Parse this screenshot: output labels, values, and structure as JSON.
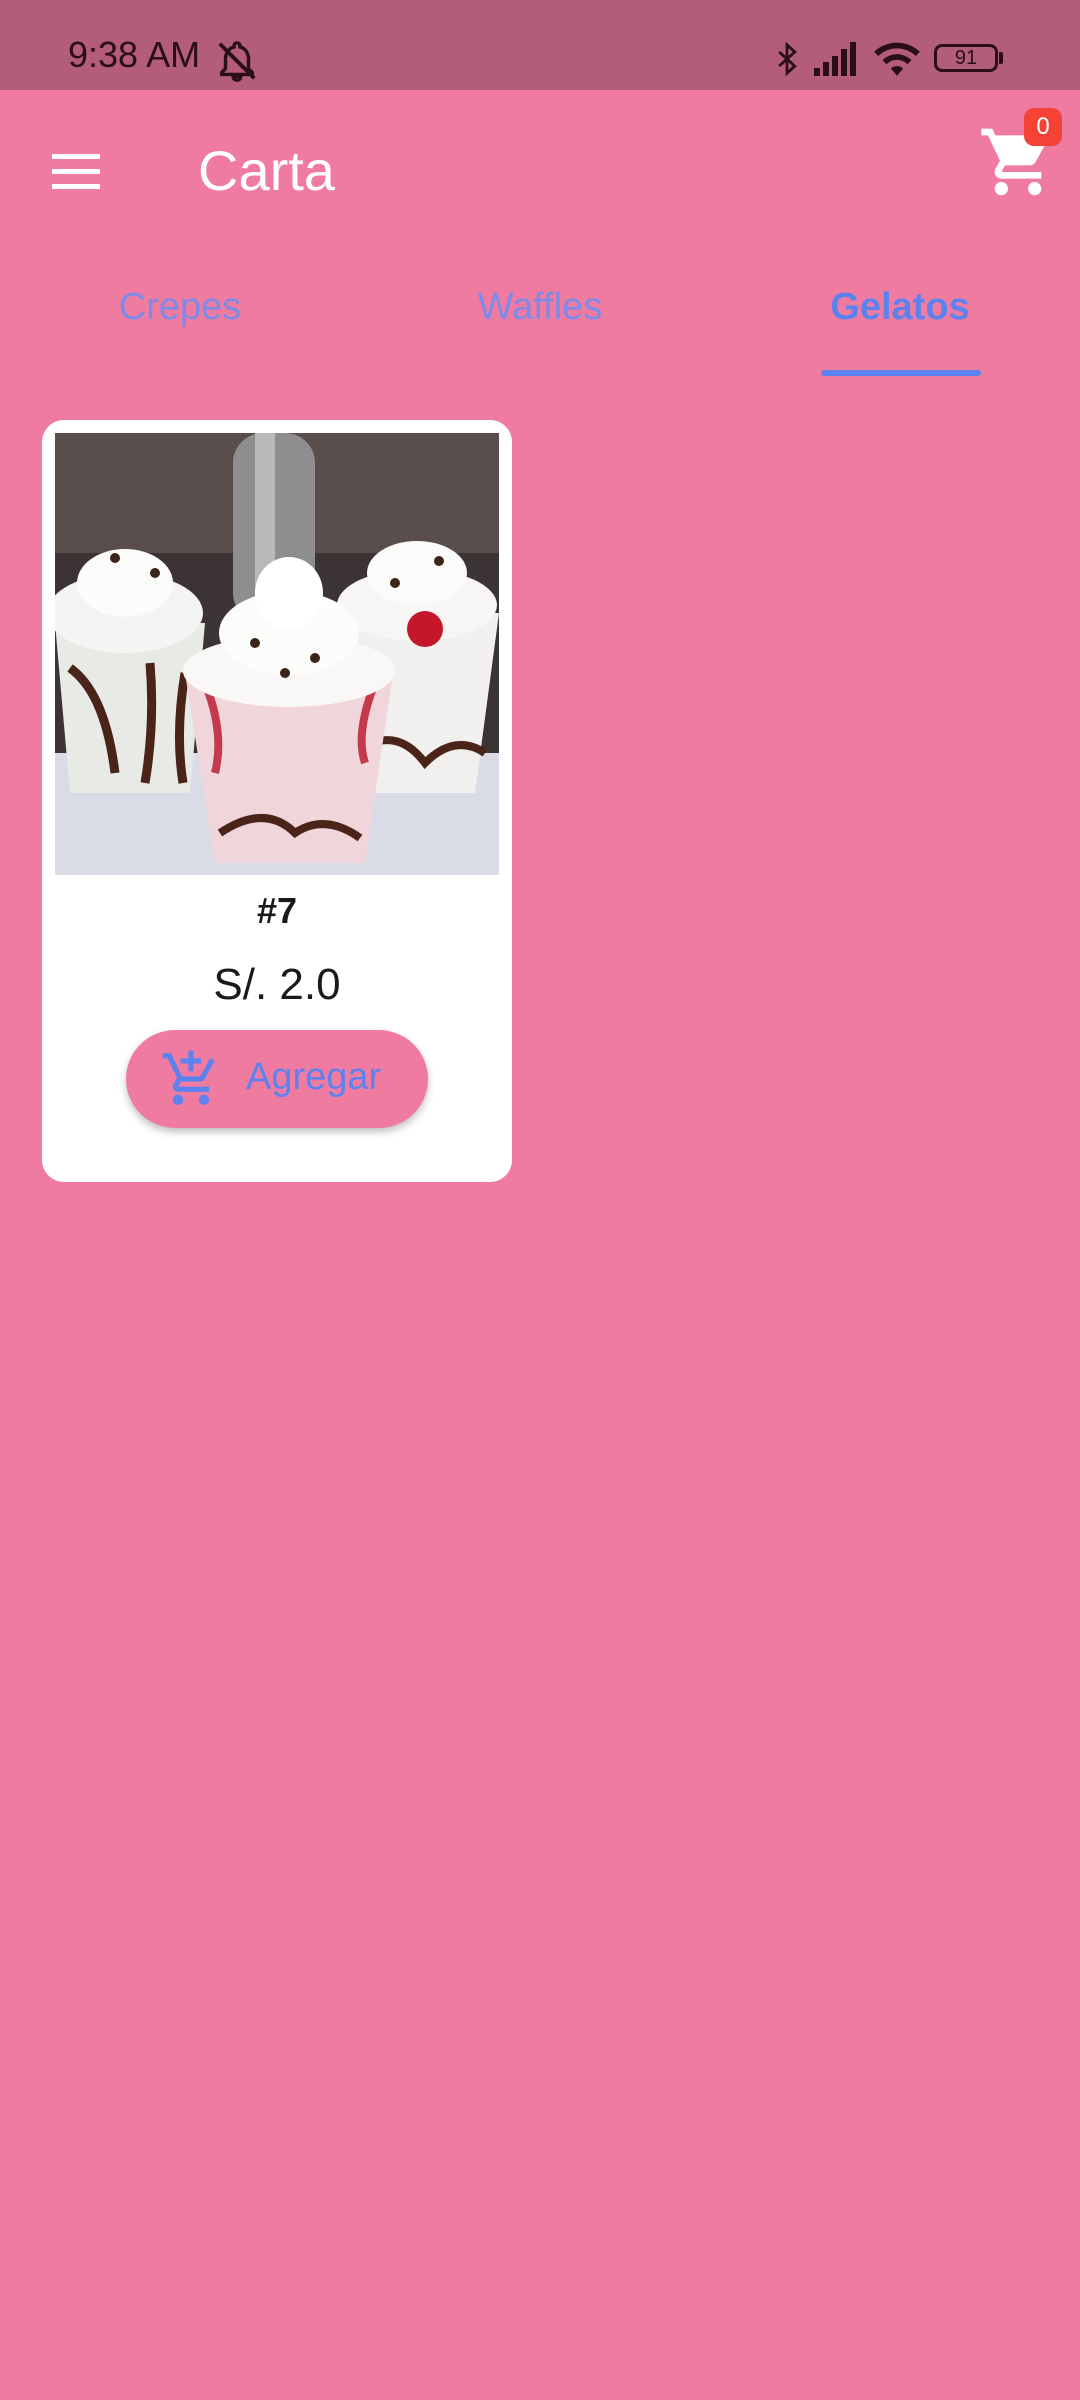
{
  "status_bar": {
    "time": "9:38 AM",
    "battery": "91",
    "icons": [
      "mute-icon",
      "bluetooth-icon",
      "signal-icon",
      "wifi-icon",
      "battery-icon"
    ]
  },
  "app_bar": {
    "title": "Carta",
    "cart_count": "0",
    "icons": [
      "menu-icon",
      "cart-icon"
    ]
  },
  "tabs": [
    {
      "label": "Crepes",
      "active": false
    },
    {
      "label": "Waffles",
      "active": false
    },
    {
      "label": "Gelatos",
      "active": true
    }
  ],
  "products": [
    {
      "name": "#7",
      "price": "S/. 2.0",
      "button_label": "Agregar",
      "button_icon": "add-to-cart-icon"
    }
  ],
  "colors": {
    "background": "#F07BA1",
    "status_bar": "#B35D7B",
    "accent": "#5C82F0",
    "badge": "#F44336"
  }
}
